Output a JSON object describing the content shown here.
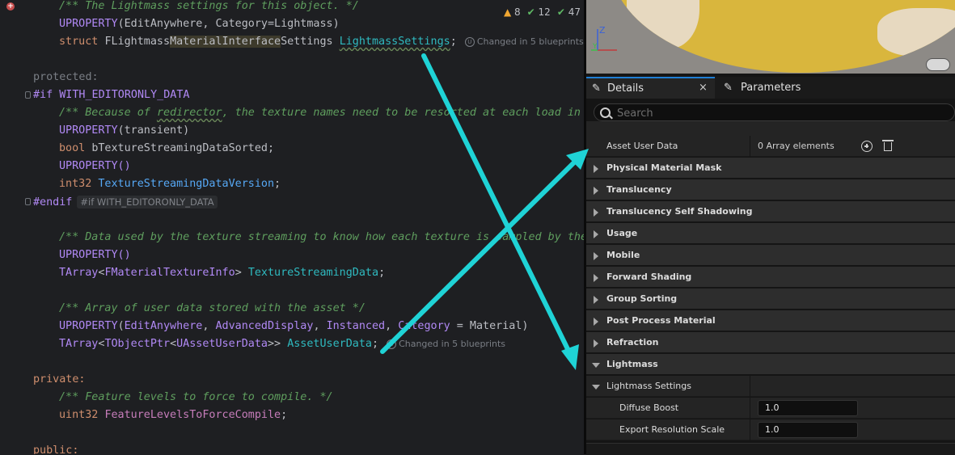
{
  "editor": {
    "inspections": {
      "warnings": "8",
      "ok": "12",
      "other": "47"
    },
    "hint_changed": "Changed in 5 blueprints",
    "hint_changed2": "Changed in 5 blueprints",
    "inlay_endif": "#if WITH_EDITORONLY_DATA",
    "lines": {
      "l1": "/** The Lightmass settings for this object. */",
      "l2a": "UPROPERTY",
      "l2b": "(EditAnywhere, Category=Lightmass)",
      "l3a": "struct ",
      "l3b": "FLightmass",
      "l3c": "MaterialInterface",
      "l3d": "Settings ",
      "l3e": "LightmassSettings",
      "l3f": ";",
      "l5": "protected:",
      "l6a": "#if ",
      "l6b": "WITH_EDITORONLY_DATA",
      "l7a": "/** Because of ",
      "l7b": "redirector",
      "l7c": ", the texture names need to be resorted at each load in",
      "l8a": "UPROPERTY",
      "l8b": "(transient)",
      "l9a": "bool ",
      "l9b": "bTextureStreamingDataSorted",
      "l9c": ";",
      "l10": "UPROPERTY()",
      "l11a": "int32 ",
      "l11b": "TextureStreamingDataVersion",
      "l11c": ";",
      "l12": "#endif",
      "l14": "/** Data used by the texture streaming to know how each texture is sampled by the",
      "l15": "UPROPERTY()",
      "l16a": "TArray",
      "l16b": "<",
      "l16c": "FMaterialTextureInfo",
      "l16d": "> ",
      "l16e": "TextureStreamingData",
      "l16f": ";",
      "l18": "/** Array of user data stored with the asset */",
      "l19a": "UPROPERTY",
      "l19b": "(",
      "l19c": "EditAnywhere",
      "l19d": ", ",
      "l19e": "AdvancedDisplay",
      "l19f": ", ",
      "l19g": "Instanced",
      "l19h": ", ",
      "l19i": "Category",
      "l19j": " = Material)",
      "l20a": "TArray",
      "l20b": "<",
      "l20c": "TObjectPtr",
      "l20d": "<",
      "l20e": "UAssetUserData",
      "l20f": ">> ",
      "l20g": "AssetUserData",
      "l20h": ";",
      "l22": "private:",
      "l23": "/** Feature levels to force to compile. */",
      "l24a": "uint32 ",
      "l24b": "FeatureLevelsToForceCompile",
      "l24c": ";",
      "l26": "public:"
    }
  },
  "panel": {
    "tabs": {
      "details": "Details",
      "parameters": "Parameters",
      "close": "×"
    },
    "search": {
      "placeholder": "Search"
    },
    "asset_user_data": {
      "label": "Asset User Data",
      "value": "0 Array elements"
    },
    "categories": [
      "Physical Material Mask",
      "Translucency",
      "Translucency Self Shadowing",
      "Usage",
      "Mobile",
      "Forward Shading",
      "Group Sorting",
      "Post Process Material",
      "Refraction",
      "Lightmass"
    ],
    "lightmass_settings": {
      "label": "Lightmass Settings"
    },
    "diffuse_boost": {
      "label": "Diffuse Boost",
      "value": "1.0"
    },
    "export_resolution_scale": {
      "label": "Export Resolution Scale",
      "value": "1.0"
    },
    "axes": {
      "z": "Z",
      "y": "Y"
    }
  },
  "colors": {
    "annotation_arrow": "#1fd3d6",
    "accent": "#1f7ed4"
  }
}
